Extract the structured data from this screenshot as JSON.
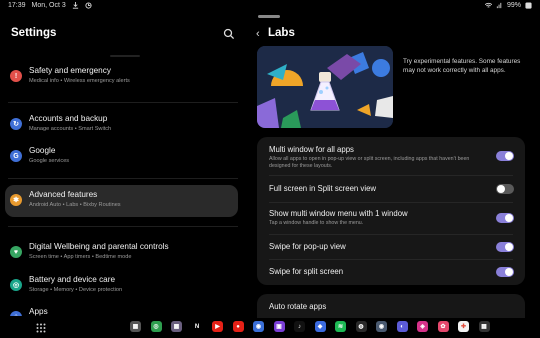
{
  "status_bar": {
    "time": "17:39",
    "date": "Mon, Oct 3",
    "battery": "99%"
  },
  "left": {
    "title": "Settings",
    "items": [
      {
        "title": "Safety and emergency",
        "subtitle": "Medical info  •  Wireless emergency alerts",
        "icon": "siren-icon",
        "color": "#e2504a"
      },
      {
        "title": "Accounts and backup",
        "subtitle": "Manage accounts  •  Smart Switch",
        "icon": "sync-icon",
        "color": "#3f6fd6"
      },
      {
        "title": "Google",
        "subtitle": "Google services",
        "icon": "google-icon",
        "color": "#3f6fd6"
      },
      {
        "title": "Advanced features",
        "subtitle": "Android Auto  •  Labs  •  Bixby Routines",
        "icon": "gear-star-icon",
        "color": "#e89a2e"
      },
      {
        "title": "Digital Wellbeing and parental controls",
        "subtitle": "Screen time  •  App timers  •  Bedtime mode",
        "icon": "wellbeing-icon",
        "color": "#37a562"
      },
      {
        "title": "Battery and device care",
        "subtitle": "Storage  •  Memory  •  Device protection",
        "icon": "battery-care-icon",
        "color": "#1aa58a"
      },
      {
        "title": "Apps",
        "subtitle": "",
        "icon": "apps-icon",
        "color": "#3f6fd6"
      }
    ]
  },
  "right": {
    "title": "Labs",
    "intro": "Try experimental features. Some features may not work correctly with all apps.",
    "settings": [
      {
        "title": "Multi window for all apps",
        "desc": "Allow all apps to open in pop-up view or split screen, including apps that haven't been designed for these layouts.",
        "on": true
      },
      {
        "title": "Full screen in Split screen view",
        "desc": "",
        "on": false
      },
      {
        "title": "Show multi window menu with 1 window",
        "desc": "Tap a window handle to show the menu.",
        "on": true
      },
      {
        "title": "Swipe for pop-up view",
        "desc": "",
        "on": true
      },
      {
        "title": "Swipe for split screen",
        "desc": "",
        "on": true
      }
    ],
    "auto_rotate": "Auto rotate apps"
  },
  "colors": {
    "accent": "#8a80d9",
    "background": "#000000",
    "card": "#171717"
  },
  "taskbar": {
    "apps": [
      {
        "name": "grid-app-icon",
        "color": "#555555",
        "glyph": "▦"
      },
      {
        "name": "chrome-icon",
        "color": "#2e9e4f",
        "glyph": "◎"
      },
      {
        "name": "folder-app-icon",
        "color": "#6a5f7f",
        "glyph": "▦"
      },
      {
        "name": "netflix-icon",
        "color": "#000000",
        "glyph": "N"
      },
      {
        "name": "youtube-icon",
        "color": "#e62117",
        "glyph": "▶"
      },
      {
        "name": "youtube-music-icon",
        "color": "#e62117",
        "glyph": "●"
      },
      {
        "name": "messages-icon",
        "color": "#3a6fd8",
        "glyph": "◉"
      },
      {
        "name": "twitch-icon",
        "color": "#7a3ed6",
        "glyph": "▣"
      },
      {
        "name": "tiktok-icon",
        "color": "#111111",
        "glyph": "♪"
      },
      {
        "name": "messenger-icon",
        "color": "#3b6be0",
        "glyph": "◆"
      },
      {
        "name": "spotify-icon",
        "color": "#1db954",
        "glyph": "≋"
      },
      {
        "name": "game-icon",
        "color": "#2a2a2a",
        "glyph": "◍"
      },
      {
        "name": "camera-app-icon",
        "color": "#4a5a70",
        "glyph": "◉"
      },
      {
        "name": "samsung-internet-icon",
        "color": "#5b5bd6",
        "glyph": "◐"
      },
      {
        "name": "store-icon",
        "color": "#d6328a",
        "glyph": "◈"
      },
      {
        "name": "photos-icon",
        "color": "#e5486d",
        "glyph": "✿"
      },
      {
        "name": "google-photos-icon",
        "color": "#f3f3f3",
        "glyph": "✚"
      },
      {
        "name": "apps-folder-icon",
        "color": "#333333",
        "glyph": "▦"
      }
    ]
  }
}
